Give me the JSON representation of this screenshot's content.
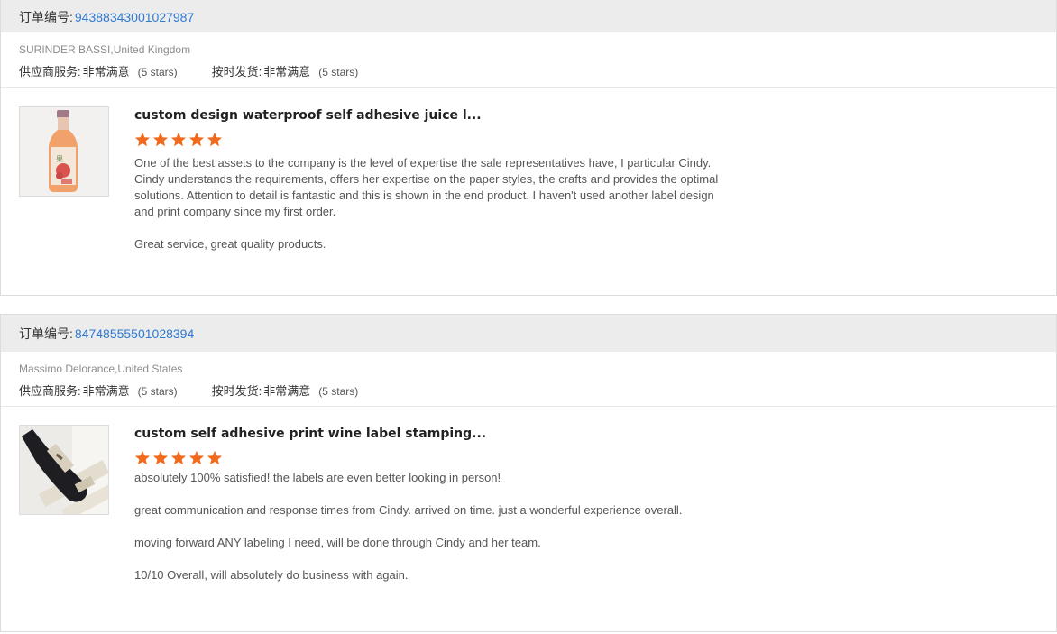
{
  "labels": {
    "order_number": "订单编号:",
    "supplier_service": "供应商服务:",
    "on_time_delivery": "按时发货:"
  },
  "colors": {
    "link": "#2f7ad1",
    "star": "#f26b1d",
    "header_bg": "#ececec"
  },
  "reviews": [
    {
      "order_number": "94388343001027987",
      "buyer": "SURINDER BASSI,United Kingdom",
      "supplier_service_value": "非常满意",
      "supplier_service_stars": "(5 stars)",
      "delivery_value": "非常满意",
      "delivery_stars": "(5 stars)",
      "product_title": "custom design waterproof self adhesive juice l...",
      "product_image": "juice-bottle-label-photo",
      "rating": 5,
      "paragraphs": [
        "One of the best assets to the company is the level of expertise the sale representatives have, I particular Cindy. Cindy understands the requirements, offers her expertise on the paper styles, the crafts and provides the optimal solutions. Attention to detail is fantastic and this is shown in the end product. I haven't used another label design and print company since my first order.",
        "Great service, great quality products."
      ]
    },
    {
      "order_number": "84748555501028394",
      "buyer": "Massimo Delorance,United States",
      "supplier_service_value": "非常满意",
      "supplier_service_stars": "(5 stars)",
      "delivery_value": "非常满意",
      "delivery_stars": "(5 stars)",
      "product_title": "custom self adhesive print wine label stamping...",
      "product_image": "wine-bottle-label-photo",
      "rating": 5,
      "paragraphs": [
        "absolutely 100% satisfied! the labels are even better looking in person!",
        "great communication and response times from Cindy. arrived on time. just a wonderful experience overall.",
        "moving forward ANY labeling I need, will be done through Cindy and her team.",
        "10/10 Overall, will absolutely do business with again."
      ]
    }
  ]
}
